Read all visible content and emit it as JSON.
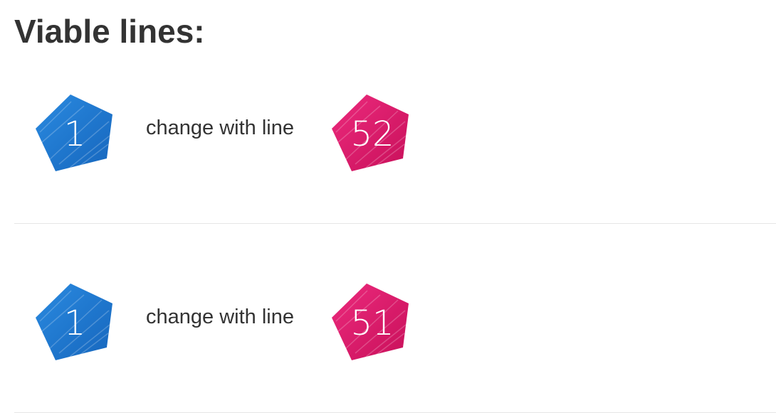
{
  "title": "Viable lines:",
  "colors": {
    "from_badge": "#1f7fd6",
    "to_badge": "#e0196d",
    "divider": "#e6e6e6",
    "text": "#333333"
  },
  "lines": [
    {
      "from_line": "1",
      "connector": "change with line",
      "to_line": "52"
    },
    {
      "from_line": "1",
      "connector": "change with line",
      "to_line": "51"
    }
  ]
}
